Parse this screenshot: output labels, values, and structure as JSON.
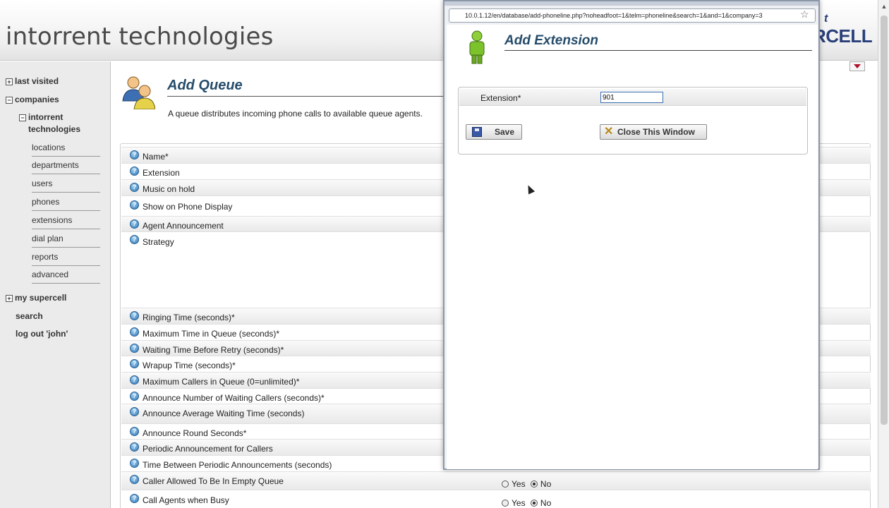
{
  "header": {
    "company_title": "intorrent technologies",
    "brand_logo": "RCELL",
    "brand_accent": "t"
  },
  "sidebar": {
    "last_visited": "last visited",
    "companies": "companies",
    "company_name_line1": "intorrent",
    "company_name_line2": "technologies",
    "items": [
      "locations",
      "departments",
      "users",
      "phones",
      "extensions",
      "dial plan",
      "reports",
      "advanced"
    ],
    "my_supercell": "my supercell",
    "search": "search",
    "logout": "log out 'john'"
  },
  "main": {
    "title": "Add Queue",
    "description": "A queue distributes incoming phone calls to available queue agents.",
    "fields": [
      "Name*",
      "Extension",
      "Music on hold",
      "Show on Phone Display",
      "Agent Announcement",
      "Strategy",
      "Ringing Time (seconds)*",
      "Maximum Time in Queue (seconds)*",
      "Waiting Time Before Retry (seconds)*",
      "Wrapup Time (seconds)*",
      "Maximum Callers in Queue (0=unlimited)*",
      "Announce Number of Waiting Callers (seconds)*",
      "Announce Average Waiting Time (seconds)",
      "Announce Round Seconds*",
      "Periodic Announcement for Callers",
      "Time Between Periodic Announcements (seconds)",
      "Caller Allowed To Be In Empty Queue",
      "Call Agents when Busy"
    ],
    "yes_label": "Yes",
    "no_label": "No"
  },
  "popup": {
    "url": "10.0.1.12/en/database/add-phoneline.php?noheadfoot=1&telm=phoneline&search=1&and=1&company=3",
    "title": "Add Extension",
    "extension_label": "Extension*",
    "extension_value": "901",
    "save_label": "Save",
    "close_label": "Close This Window"
  },
  "colors": {
    "title_blue": "#254c6b",
    "dropdown_red": "#b0102a"
  }
}
